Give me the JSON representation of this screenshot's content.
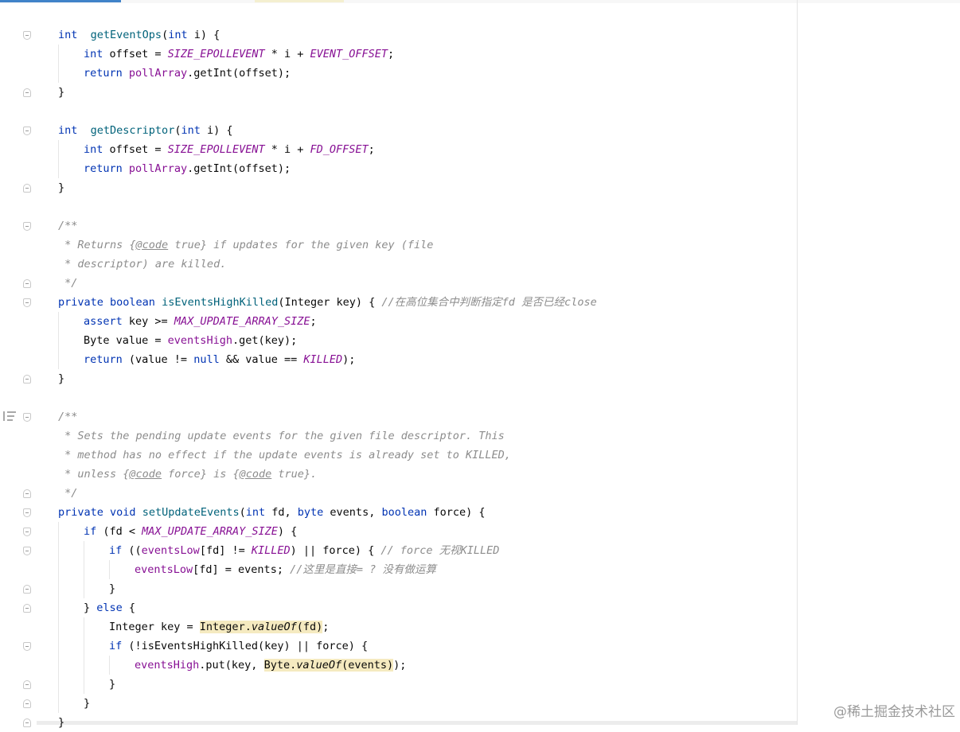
{
  "code_lines": [
    {
      "row": 0,
      "indent": 0,
      "fold": "open",
      "tokens": [
        [
          "kw",
          "int"
        ],
        [
          "",
          "  "
        ],
        [
          "fn",
          "getEventOps"
        ],
        [
          "",
          "("
        ],
        [
          "kw",
          "int"
        ],
        [
          "",
          " i) {"
        ]
      ]
    },
    {
      "row": 1,
      "indent": 1,
      "tokens": [
        [
          "kw",
          "int"
        ],
        [
          "",
          " offset = "
        ],
        [
          "st",
          "SIZE_EPOLLEVENT"
        ],
        [
          "",
          " * i + "
        ],
        [
          "st",
          "EVENT_OFFSET"
        ],
        [
          "",
          ";"
        ]
      ]
    },
    {
      "row": 2,
      "indent": 1,
      "tokens": [
        [
          "kw",
          "return"
        ],
        [
          "",
          " "
        ],
        [
          "fld",
          "pollArray"
        ],
        [
          "",
          ".getInt(offset);"
        ]
      ]
    },
    {
      "row": 3,
      "indent": 0,
      "fold": "close",
      "tokens": [
        [
          "",
          "}"
        ]
      ]
    },
    {
      "row": 5,
      "indent": 0,
      "fold": "open",
      "tokens": [
        [
          "kw",
          "int"
        ],
        [
          "",
          "  "
        ],
        [
          "fn",
          "getDescriptor"
        ],
        [
          "",
          "("
        ],
        [
          "kw",
          "int"
        ],
        [
          "",
          " i) {"
        ]
      ]
    },
    {
      "row": 6,
      "indent": 1,
      "tokens": [
        [
          "kw",
          "int"
        ],
        [
          "",
          " offset = "
        ],
        [
          "st",
          "SIZE_EPOLLEVENT"
        ],
        [
          "",
          " * i + "
        ],
        [
          "st",
          "FD_OFFSET"
        ],
        [
          "",
          ";"
        ]
      ]
    },
    {
      "row": 7,
      "indent": 1,
      "tokens": [
        [
          "kw",
          "return"
        ],
        [
          "",
          " "
        ],
        [
          "fld",
          "pollArray"
        ],
        [
          "",
          ".getInt(offset);"
        ]
      ]
    },
    {
      "row": 8,
      "indent": 0,
      "fold": "close",
      "tokens": [
        [
          "",
          "}"
        ]
      ]
    },
    {
      "row": 10,
      "indent": 0,
      "fold": "open",
      "tokens": [
        [
          "cm",
          "/**"
        ]
      ]
    },
    {
      "row": 11,
      "indent": 0,
      "tokens": [
        [
          "cm",
          " * Returns {"
        ],
        [
          "tag",
          "@code"
        ],
        [
          "cm",
          " true} if updates for the given key (file"
        ]
      ]
    },
    {
      "row": 12,
      "indent": 0,
      "tokens": [
        [
          "cm",
          " * descriptor) are killed."
        ]
      ]
    },
    {
      "row": 13,
      "indent": 0,
      "fold": "close",
      "tokens": [
        [
          "cm",
          " */"
        ]
      ]
    },
    {
      "row": 14,
      "indent": 0,
      "fold": "open",
      "tokens": [
        [
          "kw",
          "private boolean"
        ],
        [
          "",
          " "
        ],
        [
          "fn",
          "isEventsHighKilled"
        ],
        [
          "",
          "(Integer key) { "
        ],
        [
          "cm",
          "//在高位集合中判断指定fd 是否已经close"
        ]
      ]
    },
    {
      "row": 15,
      "indent": 1,
      "tokens": [
        [
          "kw",
          "assert"
        ],
        [
          "",
          " key >= "
        ],
        [
          "st",
          "MAX_UPDATE_ARRAY_SIZE"
        ],
        [
          "",
          ";"
        ]
      ]
    },
    {
      "row": 16,
      "indent": 1,
      "tokens": [
        [
          "",
          "Byte value = "
        ],
        [
          "fld",
          "eventsHigh"
        ],
        [
          "",
          ".get(key);"
        ]
      ]
    },
    {
      "row": 17,
      "indent": 1,
      "tokens": [
        [
          "kw",
          "return"
        ],
        [
          "",
          " (value != "
        ],
        [
          "kw",
          "null"
        ],
        [
          "",
          " && value == "
        ],
        [
          "st",
          "KILLED"
        ],
        [
          "",
          ");"
        ]
      ]
    },
    {
      "row": 18,
      "indent": 0,
      "fold": "close",
      "tokens": [
        [
          "",
          "}"
        ]
      ]
    },
    {
      "row": 20,
      "indent": 0,
      "fold": "open",
      "tokens": [
        [
          "cm",
          "/**"
        ]
      ]
    },
    {
      "row": 21,
      "indent": 0,
      "tokens": [
        [
          "cm",
          " * Sets the pending update events for the given file descriptor. This"
        ]
      ]
    },
    {
      "row": 22,
      "indent": 0,
      "tokens": [
        [
          "cm",
          " * method has no effect if the update events is already set to KILLED,"
        ]
      ]
    },
    {
      "row": 23,
      "indent": 0,
      "tokens": [
        [
          "cm",
          " * unless {"
        ],
        [
          "tag",
          "@code"
        ],
        [
          "cm",
          " force} is {"
        ],
        [
          "tag",
          "@code"
        ],
        [
          "cm",
          " true}."
        ]
      ]
    },
    {
      "row": 24,
      "indent": 0,
      "fold": "close",
      "tokens": [
        [
          "cm",
          " */"
        ]
      ]
    },
    {
      "row": 25,
      "indent": 0,
      "fold": "open",
      "tokens": [
        [
          "kw",
          "private void"
        ],
        [
          "",
          " "
        ],
        [
          "fn",
          "setUpdateEvents"
        ],
        [
          "",
          "("
        ],
        [
          "kw",
          "int"
        ],
        [
          "",
          " fd, "
        ],
        [
          "kw",
          "byte"
        ],
        [
          "",
          " events, "
        ],
        [
          "kw",
          "boolean"
        ],
        [
          "",
          " force) {"
        ]
      ]
    },
    {
      "row": 26,
      "indent": 1,
      "fold": "open",
      "tokens": [
        [
          "kw",
          "if"
        ],
        [
          "",
          " (fd < "
        ],
        [
          "st",
          "MAX_UPDATE_ARRAY_SIZE"
        ],
        [
          "",
          ") {"
        ]
      ]
    },
    {
      "row": 27,
      "indent": 2,
      "fold": "open",
      "tokens": [
        [
          "kw",
          "if"
        ],
        [
          "",
          " (("
        ],
        [
          "fld",
          "eventsLow"
        ],
        [
          "",
          "[fd] != "
        ],
        [
          "st",
          "KILLED"
        ],
        [
          "",
          ") || force) { "
        ],
        [
          "cm",
          "// force 无视KILLED"
        ]
      ]
    },
    {
      "row": 28,
      "indent": 3,
      "tokens": [
        [
          "fld",
          "eventsLow"
        ],
        [
          "",
          "[fd] = events; "
        ],
        [
          "cm",
          "//这里是直接= ? 没有做运算"
        ]
      ]
    },
    {
      "row": 29,
      "indent": 2,
      "fold": "close",
      "tokens": [
        [
          "",
          "}"
        ]
      ]
    },
    {
      "row": 30,
      "indent": 1,
      "fold": "close",
      "tokens": [
        [
          "",
          "} "
        ],
        [
          "kw",
          "else"
        ],
        [
          "",
          " {"
        ]
      ]
    },
    {
      "row": 31,
      "indent": 2,
      "tokens": [
        [
          "",
          "Integer key = "
        ],
        [
          "hl",
          "Integer."
        ],
        [
          "hlmi",
          "valueOf"
        ],
        [
          "hl",
          "(fd)"
        ],
        [
          "",
          ";"
        ]
      ]
    },
    {
      "row": 32,
      "indent": 2,
      "fold": "open",
      "tokens": [
        [
          "kw",
          "if"
        ],
        [
          "",
          " (!isEventsHighKilled(key) || force) {"
        ]
      ]
    },
    {
      "row": 33,
      "indent": 3,
      "tokens": [
        [
          "fld",
          "eventsHigh"
        ],
        [
          "",
          ".put(key, "
        ],
        [
          "hl",
          "Byte."
        ],
        [
          "hlmi",
          "valueOf"
        ],
        [
          "hl",
          "(events)"
        ],
        [
          "",
          ");"
        ]
      ]
    },
    {
      "row": 34,
      "indent": 2,
      "fold": "close",
      "tokens": [
        [
          "",
          "}"
        ]
      ]
    },
    {
      "row": 35,
      "indent": 1,
      "fold": "close",
      "tokens": [
        [
          "",
          "}"
        ]
      ]
    },
    {
      "row": 36,
      "indent": 0,
      "fold": "close",
      "tokens": [
        [
          "",
          "}"
        ]
      ]
    }
  ],
  "watermark": "@稀土掘金技术社区",
  "colors": {
    "keyword": "#0033b3",
    "method": "#00627a",
    "static_field": "#871094",
    "comment": "#8c8c8c",
    "highlight": "#f5eac0",
    "tab_accent": "#4083c9"
  },
  "icons": [
    "fold-marker-icon",
    "doc-render-icon"
  ]
}
